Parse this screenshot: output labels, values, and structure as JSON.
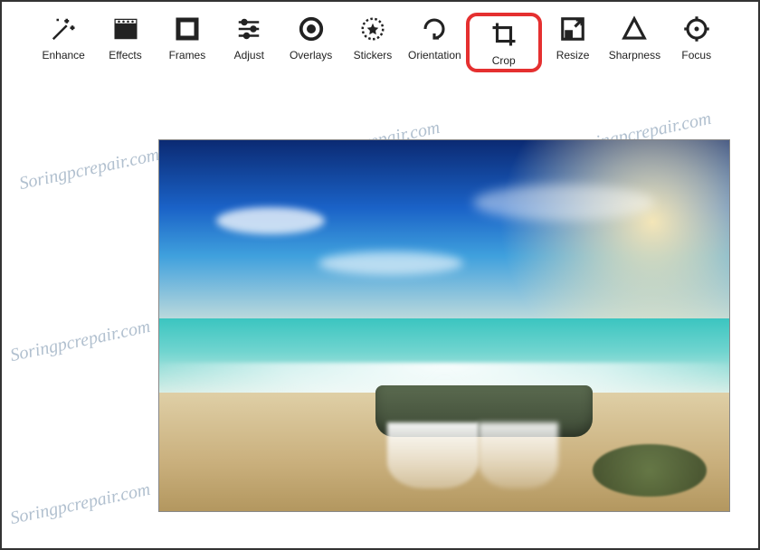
{
  "toolbar": {
    "items": [
      {
        "id": "enhance",
        "label": "Enhance",
        "icon": "enhance-icon"
      },
      {
        "id": "effects",
        "label": "Effects",
        "icon": "effects-icon"
      },
      {
        "id": "frames",
        "label": "Frames",
        "icon": "frames-icon"
      },
      {
        "id": "adjust",
        "label": "Adjust",
        "icon": "adjust-icon"
      },
      {
        "id": "overlays",
        "label": "Overlays",
        "icon": "overlays-icon"
      },
      {
        "id": "stickers",
        "label": "Stickers",
        "icon": "stickers-icon"
      },
      {
        "id": "orientation",
        "label": "Orientation",
        "icon": "orientation-icon"
      },
      {
        "id": "crop",
        "label": "Crop",
        "icon": "crop-icon",
        "highlighted": true
      },
      {
        "id": "resize",
        "label": "Resize",
        "icon": "resize-icon"
      },
      {
        "id": "sharpness",
        "label": "Sharpness",
        "icon": "sharpness-icon"
      },
      {
        "id": "focus",
        "label": "Focus",
        "icon": "focus-icon"
      }
    ]
  },
  "watermark_text": "Soringpcrepair.com",
  "image_description": "Seascape: sandy beach, waves flowing over mossy rock ledge, turquoise sea, deep blue sky with clouds"
}
